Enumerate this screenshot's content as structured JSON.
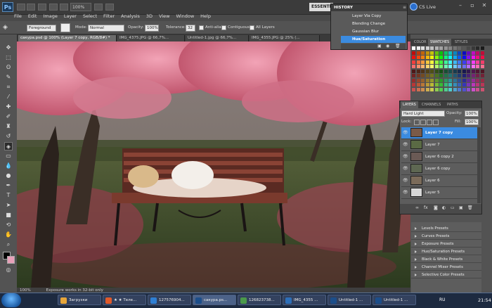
{
  "app": {
    "logo_text": "Ps",
    "zoom": "100%",
    "workspace": "ESSENTIALS",
    "cs_live": "CS Live"
  },
  "menu": [
    "File",
    "Edit",
    "Image",
    "Layer",
    "Select",
    "Filter",
    "Analysis",
    "3D",
    "View",
    "Window",
    "Help"
  ],
  "options": {
    "foreground": "Foreground",
    "mode_label": "Mode:",
    "mode_value": "Normal",
    "opacity_label": "Opacity:",
    "opacity_value": "100%",
    "tolerance_label": "Tolerance:",
    "tolerance_value": "32",
    "antialias": "Anti-alias",
    "contiguous": "Contiguous",
    "all_layers": "All Layers"
  },
  "doc_tabs": [
    "сакура.psd @ 100% (Layer 7 copy, RGB/8#) *",
    "IMG_4375.JPG @ 66,7%...",
    "Untitled-1.jpg @ 66,7%...",
    "IMG_4355.JPG @ 25% (..."
  ],
  "status": {
    "zoom": "100%",
    "message": "Exposure works in 32-bit only"
  },
  "history": {
    "title": "HISTORY",
    "items": [
      "Layer Via Copy",
      "Blending Change",
      "Gaussian Blur",
      "Hue/Saturation"
    ],
    "active_index": 3
  },
  "swatch_tabs": [
    "COLOR",
    "SWATCHES",
    "STYLES"
  ],
  "layers": {
    "tabs": [
      "LAYERS",
      "CHANNELS",
      "PATHS"
    ],
    "blend_mode": "Hard Light",
    "opacity_label": "Opacity:",
    "opacity_value": "100%",
    "lock_label": "Lock:",
    "fill_label": "Fill:",
    "fill_value": "100%",
    "items": [
      "Layer 7 copy",
      "Layer 7",
      "Layer 6 copy 2",
      "Layer 6 copy",
      "Layer 6",
      "Layer 5"
    ],
    "active_index": 0
  },
  "adjust_presets": [
    "Levels Presets",
    "Curves Presets",
    "Exposure Presets",
    "Hue/Saturation Presets",
    "Black & White Presets",
    "Channel Mixer Presets",
    "Selective Color Presets"
  ],
  "taskbar": {
    "items": [
      "Загрузки",
      "★ ★ Теле...",
      "127576904...",
      "сакура.ps...",
      "126823738...",
      "IMG_4355 ...",
      "Untitled-1 ...",
      "Untitled-1 ..."
    ],
    "active_index": 3,
    "lang": "RU",
    "time": "21:54"
  },
  "colors": {
    "accent": "#3b8be0",
    "panel_bg": "#535353",
    "taskbar": "#1d2a40"
  }
}
